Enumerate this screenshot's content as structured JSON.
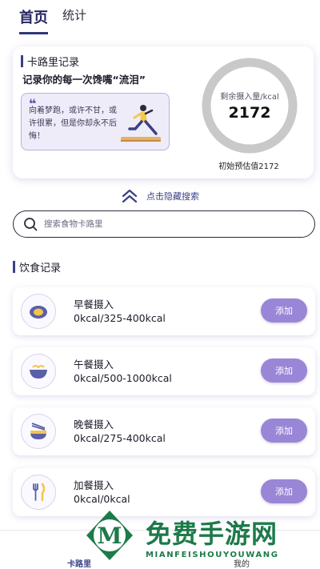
{
  "tabs": [
    {
      "label": "首页",
      "active": true
    },
    {
      "label": "统计",
      "active": false
    }
  ],
  "summary": {
    "section_title": "卡路里记录",
    "slogan": "记录你的每一次馋嘴“流泪”",
    "quote_mark": "❝",
    "quote": "向着梦跑，或许不甘，或许很累，但是你却永不后悔！",
    "remaining_label": "剩余摄入量/kcal",
    "remaining_value": "2172",
    "estimate": "初始预估值2172",
    "ring_color": "#c9c9c9"
  },
  "hide_search": {
    "label": "点击隐藏搜索",
    "icon": "double-chevron-up-icon"
  },
  "search": {
    "placeholder": "搜索食物卡路里",
    "value": "",
    "icon": "search-icon"
  },
  "diet_section": {
    "title": "饮食记录"
  },
  "meals": [
    {
      "name": "早餐摄入",
      "kcal": "0kcal/325-400kcal",
      "icon": "egg-icon",
      "add_label": "添加"
    },
    {
      "name": "午餐摄入",
      "kcal": "0kcal/500-1000kcal",
      "icon": "noodle-bowl-icon",
      "add_label": "添加"
    },
    {
      "name": "晚餐摄入",
      "kcal": "0kcal/275-400kcal",
      "icon": "rice-bowl-icon",
      "add_label": "添加"
    },
    {
      "name": "加餐摄入",
      "kcal": "0kcal/0kcal",
      "icon": "fork-knife-icon",
      "add_label": "添加"
    }
  ],
  "nav": {
    "home": "卡路里",
    "me": "我的"
  },
  "watermark": {
    "text": "免费手游网",
    "sub": "MIANFEISHOUYOUWANG",
    "logo_letter": "M"
  },
  "colors": {
    "accent": "#3b3f86",
    "button": "#9a86d6",
    "watermark": "#1d7a4a"
  }
}
